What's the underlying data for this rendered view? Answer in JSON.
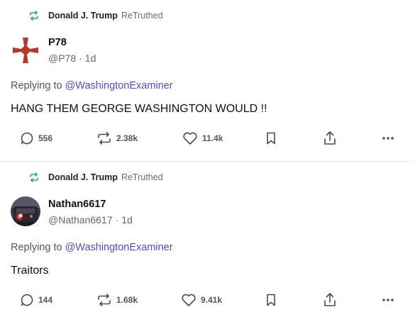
{
  "posts": [
    {
      "retruth": {
        "user": "Donald J. Trump",
        "label": "ReTruthed"
      },
      "author": {
        "display_name": "P78",
        "handle": "@P78",
        "time": "1d"
      },
      "reply": {
        "prefix": "Replying to",
        "mention": "@WashingtonExaminer"
      },
      "content": "HANG THEM GEORGE WASHINGTON WOULD !!",
      "stats": {
        "replies": "556",
        "retruths": "2.38k",
        "likes": "11.4k"
      },
      "avatar_icon": "cross-pattee-icon",
      "avatar_color": "#b5382d"
    },
    {
      "retruth": {
        "user": "Donald J. Trump",
        "label": "ReTruthed"
      },
      "author": {
        "display_name": "Nathan6617",
        "handle": "@Nathan6617",
        "time": "1d"
      },
      "reply": {
        "prefix": "Replying to",
        "mention": "@WashingtonExaminer"
      },
      "content": "Traitors",
      "stats": {
        "replies": "144",
        "retruths": "1.68k",
        "likes": "9.41k"
      },
      "avatar_icon": "train-photo-avatar"
    }
  ],
  "colors": {
    "retruth_icon": "#2fa56a",
    "mention": "#5848c2",
    "action_icon": "#4a4a4a"
  }
}
